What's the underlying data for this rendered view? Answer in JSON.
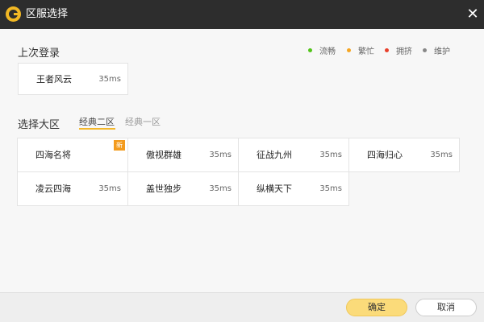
{
  "window": {
    "title": "区服选择"
  },
  "icons": {
    "app": "app-logo-icon",
    "close": "close-icon",
    "close_glyph": "✕",
    "new_badge": "新"
  },
  "legend": [
    {
      "label": "流畅",
      "color": "#52c41a"
    },
    {
      "label": "繁忙",
      "color": "#f5a623"
    },
    {
      "label": "拥挤",
      "color": "#e8402b"
    },
    {
      "label": "维护",
      "color": "#888888"
    }
  ],
  "last_login": {
    "title": "上次登录",
    "server": {
      "name": "王者风云",
      "ping": "35ms"
    }
  },
  "region": {
    "title": "选择大区",
    "tabs": [
      {
        "label": "经典二区",
        "active": true
      },
      {
        "label": "经典一区",
        "active": false
      }
    ],
    "servers": [
      {
        "name": "四海名将",
        "ping": "",
        "is_new": true
      },
      {
        "name": "傲视群雄",
        "ping": "35ms"
      },
      {
        "name": "征战九州",
        "ping": "35ms"
      },
      {
        "name": "四海归心",
        "ping": "35ms"
      },
      {
        "name": "凌云四海",
        "ping": "35ms"
      },
      {
        "name": "盖世独步",
        "ping": "35ms"
      },
      {
        "name": "纵横天下",
        "ping": "35ms"
      }
    ]
  },
  "footer": {
    "ok_label": "确定",
    "cancel_label": "取消"
  }
}
